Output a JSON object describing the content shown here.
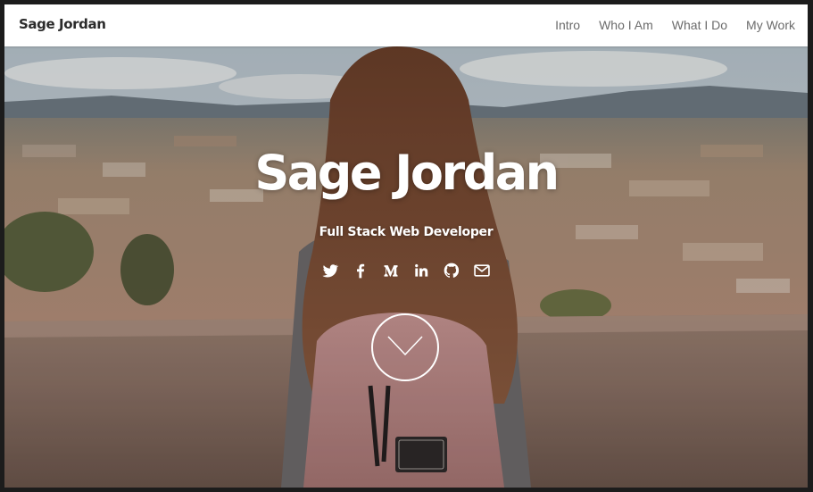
{
  "navbar": {
    "brand": "Sage Jordan",
    "links": [
      "Intro",
      "Who I Am",
      "What I Do",
      "My Work"
    ]
  },
  "hero": {
    "title": "Sage Jordan",
    "subtitle": "Full Stack Web Developer",
    "social_icons": [
      "twitter-icon",
      "facebook-icon",
      "medium-icon",
      "linkedin-icon",
      "github-icon",
      "email-icon"
    ],
    "scroll_icon": "chevron-down-icon"
  },
  "colors": {
    "navbar_bg": "#ffffff",
    "brand_text": "#2b2b2b",
    "nav_link": "#6b6b6b",
    "hero_text": "#ffffff"
  }
}
